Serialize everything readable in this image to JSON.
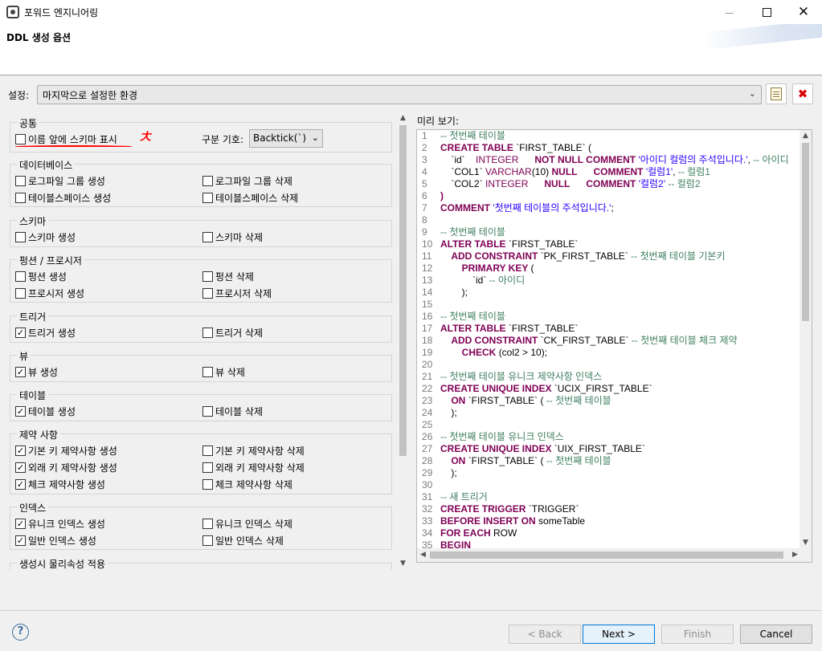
{
  "window": {
    "title": "포워드 엔지니어링",
    "minimize": "",
    "maximize": "",
    "close": "✕"
  },
  "banner": {
    "title": "DDL 생성 옵션"
  },
  "config": {
    "label": "설정:",
    "value": "마지막으로 설정한 환경"
  },
  "options": {
    "common": {
      "title": "공통",
      "show_schema": {
        "label": "이름 앞에 스키마 표시",
        "checked": false
      },
      "separator_label": "구분 기호:",
      "separator_value": "Backtick(`)"
    },
    "database": {
      "title": "데이터베이스",
      "items": [
        {
          "label": "로그파일 그룹 생성",
          "checked": false
        },
        {
          "label": "로그파일 그룹 삭제",
          "checked": false
        },
        {
          "label": "테이블스페이스 생성",
          "checked": false
        },
        {
          "label": "테이블스페이스 삭제",
          "checked": false
        }
      ]
    },
    "schema": {
      "title": "스키마",
      "items": [
        {
          "label": "스키마 생성",
          "checked": false
        },
        {
          "label": "스키마 삭제",
          "checked": false
        }
      ]
    },
    "function": {
      "title": "펑션 / 프로시저",
      "items": [
        {
          "label": "펑션 생성",
          "checked": false
        },
        {
          "label": "펑션 삭제",
          "checked": false
        },
        {
          "label": "프로시저 생성",
          "checked": false
        },
        {
          "label": "프로시저 삭제",
          "checked": false
        }
      ]
    },
    "trigger": {
      "title": "트리거",
      "items": [
        {
          "label": "트리거 생성",
          "checked": true
        },
        {
          "label": "트리거 삭제",
          "checked": false
        }
      ]
    },
    "view": {
      "title": "뷰",
      "items": [
        {
          "label": "뷰 생성",
          "checked": true
        },
        {
          "label": "뷰 삭제",
          "checked": false
        }
      ]
    },
    "table": {
      "title": "테이블",
      "items": [
        {
          "label": "테이블 생성",
          "checked": true
        },
        {
          "label": "테이블 삭제",
          "checked": false
        }
      ]
    },
    "constraint": {
      "title": "제약 사항",
      "items": [
        {
          "label": "기본 키 제약사항 생성",
          "checked": true
        },
        {
          "label": "기본 키 제약사항 삭제",
          "checked": false
        },
        {
          "label": "외래 키 제약사항 생성",
          "checked": true
        },
        {
          "label": "외래 키 제약사항 삭제",
          "checked": false
        },
        {
          "label": "체크 제약사항 생성",
          "checked": true
        },
        {
          "label": "체크 제약사항 삭제",
          "checked": false
        }
      ]
    },
    "index": {
      "title": "인덱스",
      "items": [
        {
          "label": "유니크 인덱스 생성",
          "checked": true
        },
        {
          "label": "유니크 인덱스 삭제",
          "checked": false
        },
        {
          "label": "일반 인덱스 생성",
          "checked": true
        },
        {
          "label": "일반 인덱스 삭제",
          "checked": false
        }
      ]
    },
    "physical": {
      "title": "생성시 물리속성 적용"
    }
  },
  "preview": {
    "label": "미리 보기:",
    "lines": [
      [
        [
          "cm",
          "-- 첫번째 테이블"
        ]
      ],
      [
        [
          "kw",
          "CREATE TABLE "
        ],
        [
          "tx",
          "`FIRST_TABLE` ("
        ]
      ],
      [
        [
          "tx",
          "    `id`    "
        ],
        [
          "ty",
          "INTEGER"
        ],
        [
          "tx",
          "      "
        ],
        [
          "kw",
          "NOT NULL COMMENT "
        ],
        [
          "st",
          "'아이디 컬럼의 주석입니다.'"
        ],
        [
          "tx",
          ", "
        ],
        [
          "cm",
          "-- 아이디"
        ]
      ],
      [
        [
          "tx",
          "    `COL1` "
        ],
        [
          "ty",
          "VARCHAR"
        ],
        [
          "tx",
          "(10) "
        ],
        [
          "kw",
          "NULL"
        ],
        [
          "tx",
          "      "
        ],
        [
          "kw",
          "COMMENT "
        ],
        [
          "st",
          "'컬럼1'"
        ],
        [
          "tx",
          ", "
        ],
        [
          "cm",
          "-- 컬럼1"
        ]
      ],
      [
        [
          "tx",
          "    `COL2` "
        ],
        [
          "ty",
          "INTEGER"
        ],
        [
          "tx",
          "      "
        ],
        [
          "kw",
          "NULL"
        ],
        [
          "tx",
          "      "
        ],
        [
          "kw",
          "COMMENT "
        ],
        [
          "st",
          "'컬럼2'"
        ],
        [
          "tx",
          " "
        ],
        [
          "cm",
          "-- 컬럼2"
        ]
      ],
      [
        [
          "kw",
          ")"
        ]
      ],
      [
        [
          "kw",
          "COMMENT "
        ],
        [
          "st",
          "'첫번째 테이블의 주석입니다.'"
        ],
        [
          "tx",
          ";"
        ]
      ],
      [],
      [
        [
          "cm",
          "-- 첫번째 테이블"
        ]
      ],
      [
        [
          "kw",
          "ALTER TABLE "
        ],
        [
          "tx",
          "`FIRST_TABLE`"
        ]
      ],
      [
        [
          "tx",
          "    "
        ],
        [
          "kw",
          "ADD CONSTRAINT "
        ],
        [
          "tx",
          "`PK_FIRST_TABLE` "
        ],
        [
          "cm",
          "-- 첫번째 테이블 기본키"
        ]
      ],
      [
        [
          "tx",
          "        "
        ],
        [
          "kw",
          "PRIMARY KEY "
        ],
        [
          "tx",
          "("
        ]
      ],
      [
        [
          "tx",
          "            `id` "
        ],
        [
          "cm",
          "-- 아이디"
        ]
      ],
      [
        [
          "tx",
          "        );"
        ]
      ],
      [],
      [
        [
          "cm",
          "-- 첫번째 테이블"
        ]
      ],
      [
        [
          "kw",
          "ALTER TABLE "
        ],
        [
          "tx",
          "`FIRST_TABLE`"
        ]
      ],
      [
        [
          "tx",
          "    "
        ],
        [
          "kw",
          "ADD CONSTRAINT "
        ],
        [
          "tx",
          "`CK_FIRST_TABLE` "
        ],
        [
          "cm",
          "-- 첫번째 테이블 체크 제약"
        ]
      ],
      [
        [
          "tx",
          "        "
        ],
        [
          "kw",
          "CHECK "
        ],
        [
          "tx",
          "(col2 > 10);"
        ]
      ],
      [],
      [
        [
          "cm",
          "-- 첫번째 테이블 유니크 제약사항 인덱스"
        ]
      ],
      [
        [
          "kw",
          "CREATE UNIQUE INDEX "
        ],
        [
          "tx",
          "`UCIX_FIRST_TABLE`"
        ]
      ],
      [
        [
          "tx",
          "    "
        ],
        [
          "kw",
          "ON "
        ],
        [
          "tx",
          "`FIRST_TABLE` ( "
        ],
        [
          "cm",
          "-- 첫번째 테이블"
        ]
      ],
      [
        [
          "tx",
          "    );"
        ]
      ],
      [],
      [
        [
          "cm",
          "-- 첫번째 테이블 유니크 인덱스"
        ]
      ],
      [
        [
          "kw",
          "CREATE UNIQUE INDEX "
        ],
        [
          "tx",
          "`UIX_FIRST_TABLE`"
        ]
      ],
      [
        [
          "tx",
          "    "
        ],
        [
          "kw",
          "ON "
        ],
        [
          "tx",
          "`FIRST_TABLE` ( "
        ],
        [
          "cm",
          "-- 첫번째 테이블"
        ]
      ],
      [
        [
          "tx",
          "    );"
        ]
      ],
      [],
      [
        [
          "cm",
          "-- 새 트리거"
        ]
      ],
      [
        [
          "kw",
          "CREATE TRIGGER "
        ],
        [
          "tx",
          "`TRIGGER`"
        ]
      ],
      [
        [
          "kw",
          "BEFORE INSERT ON "
        ],
        [
          "tx",
          "someTable"
        ]
      ],
      [
        [
          "kw",
          "FOR EACH "
        ],
        [
          "tx",
          "ROW"
        ]
      ],
      [
        [
          "kw",
          "BEGIN"
        ]
      ]
    ]
  },
  "footer": {
    "help": "?",
    "back": "< Back",
    "next": "Next >",
    "finish": "Finish",
    "cancel": "Cancel"
  },
  "colors": {
    "keyword": "#7f0055",
    "comment": "#3f7f5f",
    "string": "#2a00ff",
    "annotation": "#ff0000"
  },
  "annotation": {
    "mark": "ㅊ"
  }
}
